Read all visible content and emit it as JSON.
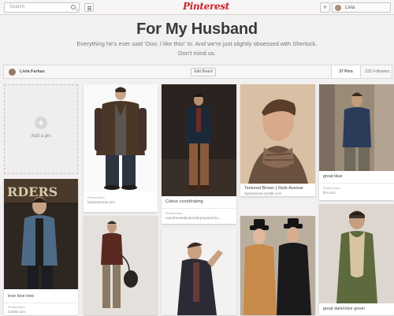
{
  "topbar": {
    "search_placeholder": "Search",
    "logo": "Pinterest",
    "add_label": "+",
    "user_name": "Livia"
  },
  "board": {
    "title": "For My Husband",
    "description": "Everything he's ever said 'Ooo, I like this!' to. And we're just slightly obsessed with Sherlock. Don't mind us.",
    "owner": "Livia Farkas",
    "edit_label": "Edit Board",
    "pins_count": "37 Pins",
    "followers_count": "332 Followers"
  },
  "add_pin_label": "Add a pin",
  "pins": [
    {
      "caption": "",
      "pinned_from_label": "Pinned from",
      "source": "luisaviaroma.com"
    },
    {
      "caption": "Colour coordinating",
      "pinned_from_label": "Pinned from",
      "source": "overdressedandunderprepared.tu..."
    },
    {
      "caption": "Textured Brown | Style Avenue",
      "pinned_from_label": "",
      "source": "styleavenue.tumblr.com"
    },
    {
      "caption": "great blue",
      "pinned_from_label": "Pinned from",
      "source": "fim.com"
    },
    {
      "caption": "love love love",
      "pinned_from_label": "Pinned from",
      "source": "tumblr.com"
    },
    {
      "caption": "",
      "pinned_from_label": "",
      "source": ""
    },
    {
      "caption": "",
      "pinned_from_label": "",
      "source": ""
    },
    {
      "caption": "",
      "pinned_from_label": "",
      "source": ""
    },
    {
      "caption": "great dark/olive green",
      "pinned_from_label": "",
      "source": ""
    }
  ]
}
